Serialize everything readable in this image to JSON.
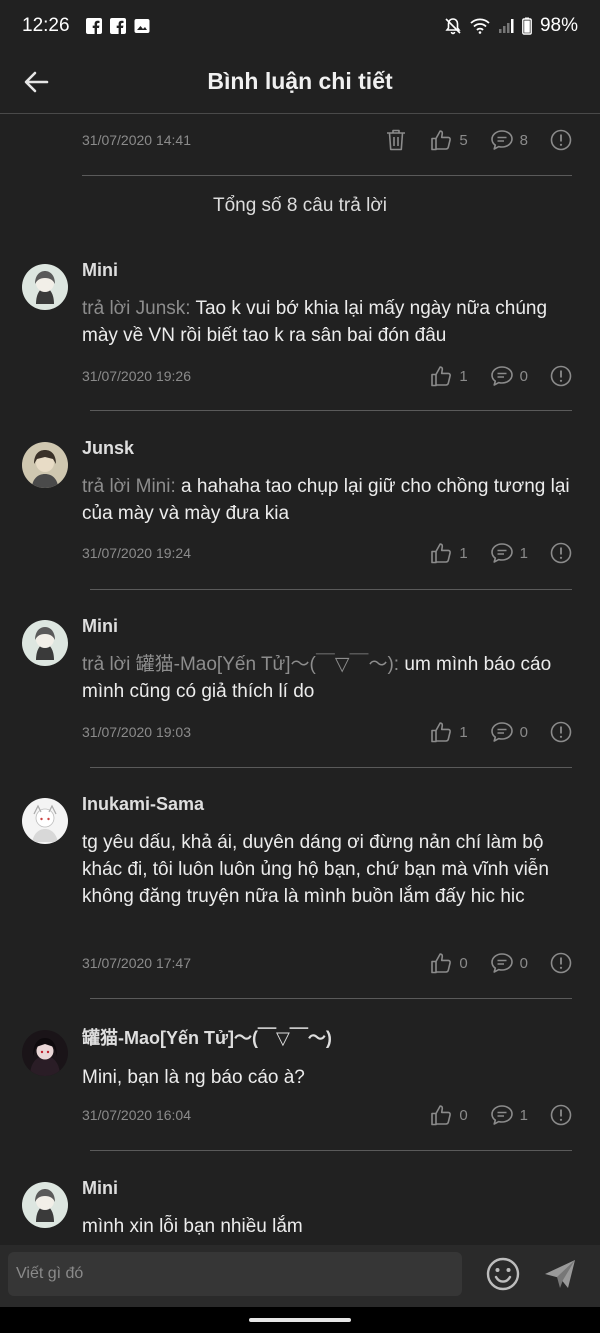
{
  "status_bar": {
    "time": "12:26",
    "battery": "98%"
  },
  "header": {
    "title": "Bình luận chi tiết"
  },
  "parent_comment": {
    "date": "31/07/2020 14:41",
    "likes": "5",
    "replies": "8"
  },
  "total_replies": "Tổng số 8 câu trả lời",
  "comments": [
    {
      "author": "Mini",
      "reply_prefix": "trả lời Junsk:",
      "text": " Tao k vui bớ khia lại mấy ngày nữa chúng mày về VN rồi biết tao k ra sân bai đón đâu",
      "date": "31/07/2020 19:26",
      "likes": "1",
      "replies": "0"
    },
    {
      "author": "Junsk",
      "reply_prefix": "trả lời Mini:",
      "text": " a hahaha tao chụp lại giữ cho chồng tương lại của mày và mày đưa kia",
      "date": "31/07/2020 19:24",
      "likes": "1",
      "replies": "1"
    },
    {
      "author": "Mini",
      "reply_prefix": "trả lời 罐猫-Mao[Yến Tử]〜(￣▽￣〜):",
      "text": " um mình báo cáo mình cũng có giả thích lí do",
      "date": "31/07/2020 19:03",
      "likes": "1",
      "replies": "0"
    },
    {
      "author": "Inukami-Sama",
      "reply_prefix": "",
      "text": "tg yêu dấu, khả ái, duyên dáng ơi đừng nản chí làm bộ khác đi, tôi luôn luôn ủng hộ bạn, chứ bạn mà vĩnh viễn không đăng truyện nữa là mình buồn lắm đấy hic hic",
      "date": "31/07/2020 17:47",
      "likes": "0",
      "replies": "0"
    },
    {
      "author": "罐猫-Mao[Yến Tử]〜(￣▽￣〜)",
      "reply_prefix": "",
      "text": "Mini, bạn là ng báo cáo à?",
      "date": "31/07/2020 16:04",
      "likes": "0",
      "replies": "1"
    },
    {
      "author": "Mini",
      "reply_prefix": "",
      "text": "mình xin lỗi bạn nhiều lắm"
    }
  ],
  "input": {
    "placeholder": "Viết gì đó"
  },
  "icons": {
    "back": "arrow-left-icon",
    "delete": "trash-icon",
    "like": "thumbs-up-icon",
    "reply": "chat-bubble-icon",
    "report": "exclamation-circle-icon",
    "emoji": "smiley-icon",
    "send": "paper-plane-icon"
  },
  "colors": {
    "background": "#212121",
    "muted_text": "#8b8b8b",
    "accent_text": "#ececec"
  }
}
